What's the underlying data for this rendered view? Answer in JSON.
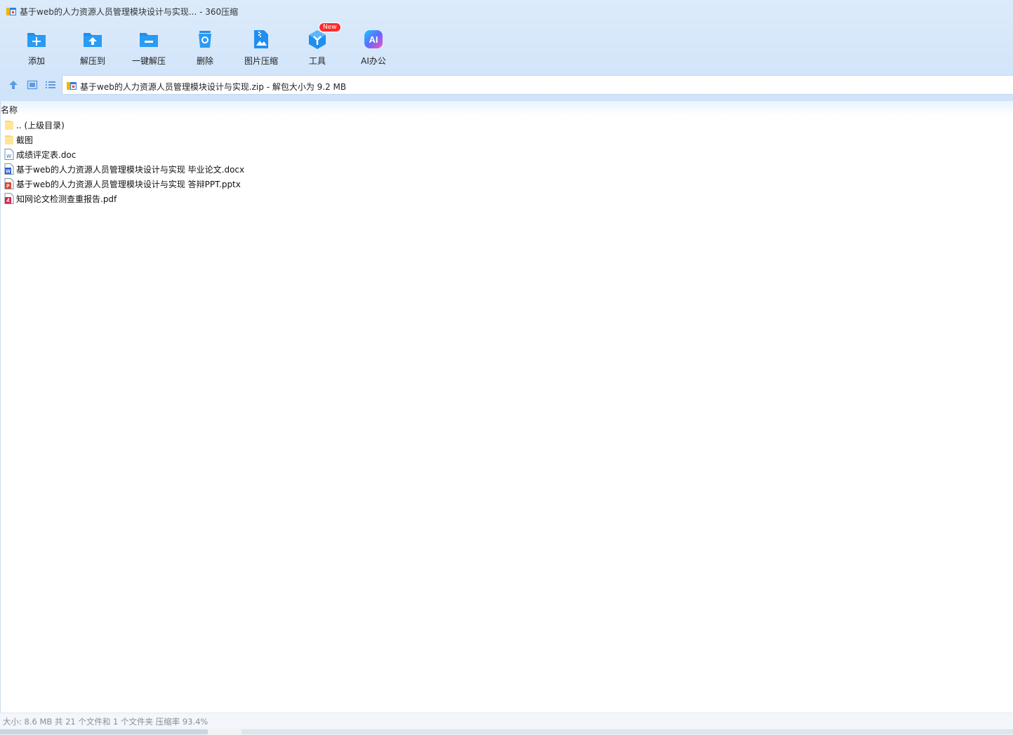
{
  "window": {
    "title": "基于web的人力资源人员管理模块设计与实现... - 360压缩",
    "app_icon": "archive-icon"
  },
  "toolbar": {
    "items": [
      {
        "label": "添加",
        "icon": "add-folder-icon"
      },
      {
        "label": "解压到",
        "icon": "extract-to-icon"
      },
      {
        "label": "一键解压",
        "icon": "one-click-extract-icon"
      },
      {
        "label": "删除",
        "icon": "recycle-bin-icon"
      },
      {
        "label": "图片压缩",
        "icon": "image-compress-icon"
      },
      {
        "label": "工具",
        "icon": "tools-cube-icon",
        "badge": "New"
      },
      {
        "label": "AI办公",
        "icon": "ai-office-icon"
      }
    ]
  },
  "address": {
    "text": "基于web的人力资源人员管理模块设计与实现.zip - 解包大小为 9.2 MB"
  },
  "list": {
    "column_name": "名称",
    "rows": [
      {
        "name": ".. (上级目录)",
        "type": "folder"
      },
      {
        "name": "截图",
        "type": "folder"
      },
      {
        "name": "成绩评定表.doc",
        "type": "doc"
      },
      {
        "name": "基于web的人力资源人员管理模块设计与实现 毕业论文.docx",
        "type": "docx"
      },
      {
        "name": "基于web的人力资源人员管理模块设计与实现 答辩PPT.pptx",
        "type": "pptx"
      },
      {
        "name": "知网论文检测查重报告.pdf",
        "type": "pdf"
      }
    ]
  },
  "status": {
    "text": "大小: 8.6 MB 共 21 个文件和 1 个文件夹 压缩率 93.4%"
  },
  "colors": {
    "accent": "#1e90f0",
    "toolbar_bg": "#d4e6fa",
    "badge": "#ff2b2b"
  }
}
